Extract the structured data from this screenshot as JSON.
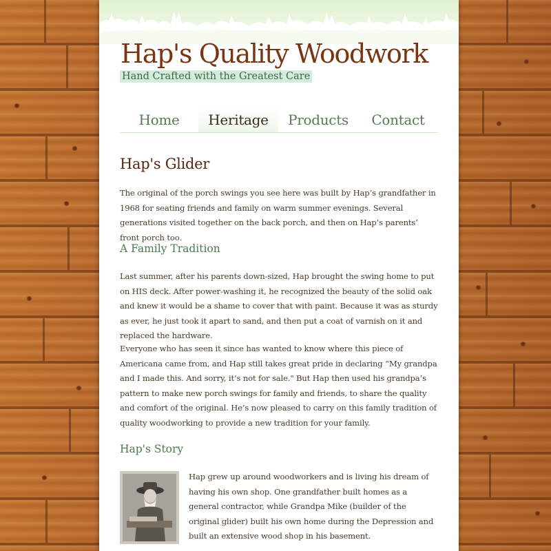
{
  "site": {
    "title": "Hap's Quality Woodwork",
    "tagline": "Hand Crafted with the Greatest Care"
  },
  "nav": [
    {
      "label": "Home",
      "active": false
    },
    {
      "label": "Heritage",
      "active": true
    },
    {
      "label": "Products",
      "active": false
    },
    {
      "label": "Contact",
      "active": false
    }
  ],
  "article": {
    "title": "Hap's Glider",
    "intro": "The original of the porch swings you see here was built by Hap’s grandfather in 1968 for seating friends and family on warm summer evenings. Several generations visited together on the back porch, and then on Hap’s parents’ front porch too.",
    "sections": [
      {
        "heading": "A Family Tradition",
        "paragraphs": [
          "Last summer, after his parents down-sized, Hap brought the swing home to put on HIS deck. After power-washing it, he recognized the beauty of the solid oak and knew it would be a shame to cover that with paint. Because it was as sturdy as ever, he just took it apart to sand, and then put a coat of varnish on it and replaced the hardware.",
          "Everyone who has seen it since has wanted to know where this piece of Americana came from, and Hap still takes great pride in declaring “My grandpa and I made this. And sorry, it’s not for sale.\" But Hap then used his grandpa’s pattern to make new porch swings for family and friends, to share the quality and comfort of the original. He’s now pleased to carry on this family tradition of quality woodworking to provide a new tradition for your family."
        ]
      },
      {
        "heading": "Hap's Story",
        "paragraphs": [
          "Hap grew up around woodworkers and is living his dream of having his own shop. One grandfather built homes as a general contractor, while Grandpa Mike (builder of the original glider) built his own home during the Depression and built an extensive wood shop in his basement."
        ]
      }
    ]
  },
  "colors": {
    "title": "#7a3510",
    "tagline_bg": "#d4ecdc",
    "subheading": "#4a7a4a",
    "wood": "#b5672a"
  },
  "icons": {
    "banner": "tree-silhouette-banner",
    "photo": "grandpa-woodworker-photo"
  }
}
